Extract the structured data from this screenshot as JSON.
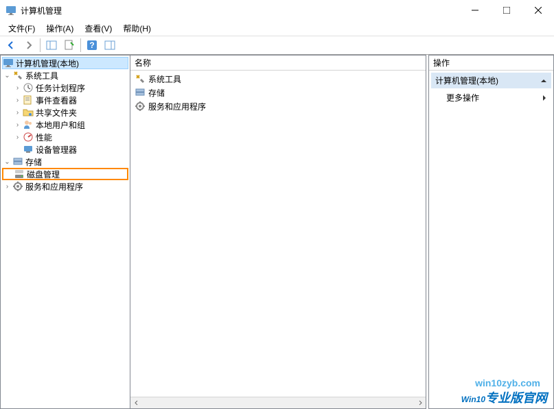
{
  "window": {
    "title": "计算机管理"
  },
  "menu": {
    "file": "文件(F)",
    "action": "操作(A)",
    "view": "查看(V)",
    "help": "帮助(H)"
  },
  "tree": {
    "root": "计算机管理(本地)",
    "system_tools": "系统工具",
    "task_scheduler": "任务计划程序",
    "event_viewer": "事件查看器",
    "shared_folders": "共享文件夹",
    "local_users": "本地用户和组",
    "performance": "性能",
    "device_manager": "设备管理器",
    "storage": "存储",
    "disk_management": "磁盘管理",
    "services_apps": "服务和应用程序"
  },
  "middle": {
    "header": "名称",
    "items": {
      "system_tools": "系统工具",
      "storage": "存储",
      "services_apps": "服务和应用程序"
    }
  },
  "actions": {
    "header": "操作",
    "group": "计算机管理(本地)",
    "more": "更多操作"
  },
  "watermark": {
    "url": "win10zyb.com",
    "brand_w": "W",
    "brand_rest": "in10",
    "brand_cn": "专业版官网"
  }
}
